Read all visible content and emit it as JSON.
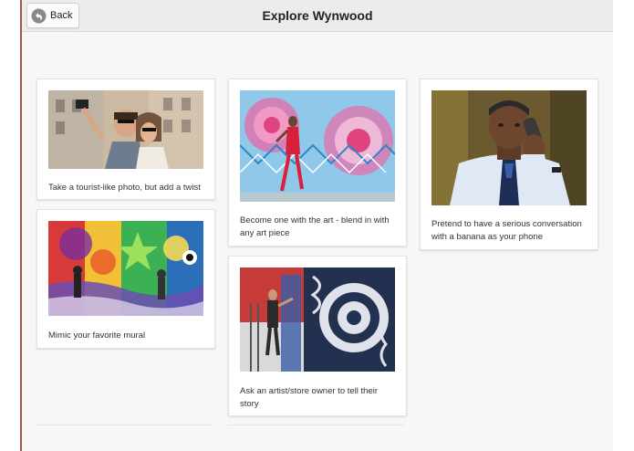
{
  "header": {
    "back_label": "Back",
    "title": "Explore Wynwood"
  },
  "cards": [
    {
      "caption": "Take a tourist-like photo, but add a twist",
      "image": "tourists-selfie-photo"
    },
    {
      "caption": "Mimic your favorite mural",
      "image": "colorful-mural-photo"
    },
    {
      "caption": "Become one with the art - blend in with any art piece",
      "image": "woman-blending-into-art-photo"
    },
    {
      "caption": "Ask an artist/store owner to tell their story",
      "image": "artist-painting-mural-photo"
    },
    {
      "caption": "Pretend to have a serious conversation with a banana as your phone",
      "image": "man-on-phone-call-photo"
    }
  ],
  "colors": {
    "topbar_bg": "#ececec",
    "page_bg": "#f7f7f7",
    "left_rule": "#9c5a4e",
    "back_icon": "#8a8a8a"
  },
  "icons": {
    "back": "back-arrow-circle-icon"
  }
}
